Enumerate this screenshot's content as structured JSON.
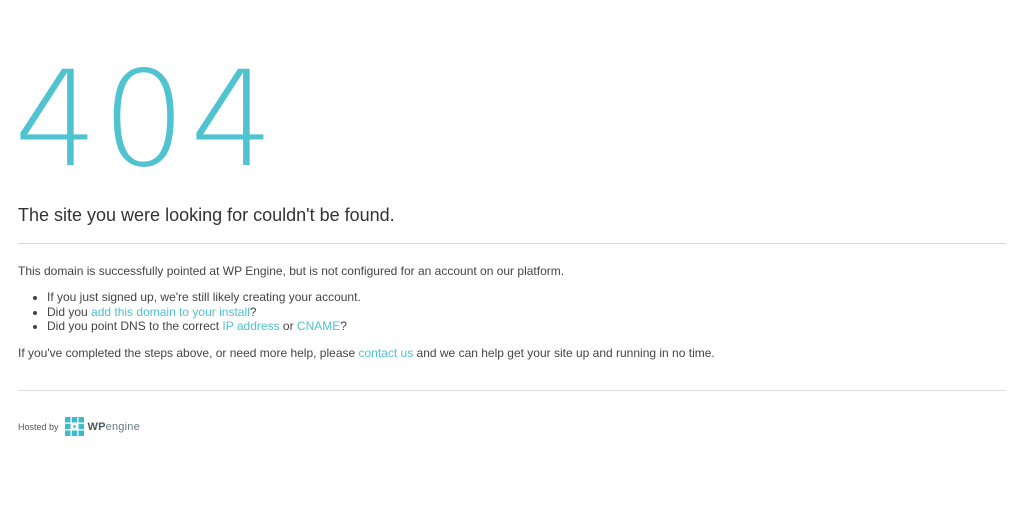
{
  "error": {
    "code": "404",
    "headline": "The site you were looking for couldn't be found."
  },
  "intro": "This domain is successfully pointed at WP Engine, but is not configured for an account on our platform.",
  "steps": {
    "item1": "If you just signed up, we're still likely creating your account.",
    "item2_prefix": "Did you ",
    "item2_link": "add this domain to your install",
    "item2_suffix": "?",
    "item3_prefix": "Did you point DNS to the correct ",
    "item3_link1": "IP address",
    "item3_middle": " or ",
    "item3_link2": "CNAME",
    "item3_suffix": "?"
  },
  "help": {
    "prefix": "If you've completed the steps above, or need more help, please ",
    "link": "contact us",
    "suffix": " and we can help get your site up and running in no time."
  },
  "footer": {
    "hosted_by": "Hosted by",
    "logo_wp": "WP",
    "logo_engine": "engine"
  },
  "colors": {
    "accent": "#4fc3cf",
    "text": "#333333",
    "divider": "#dddddd"
  },
  "icons": {
    "logo": "wpengine-logo-icon"
  }
}
